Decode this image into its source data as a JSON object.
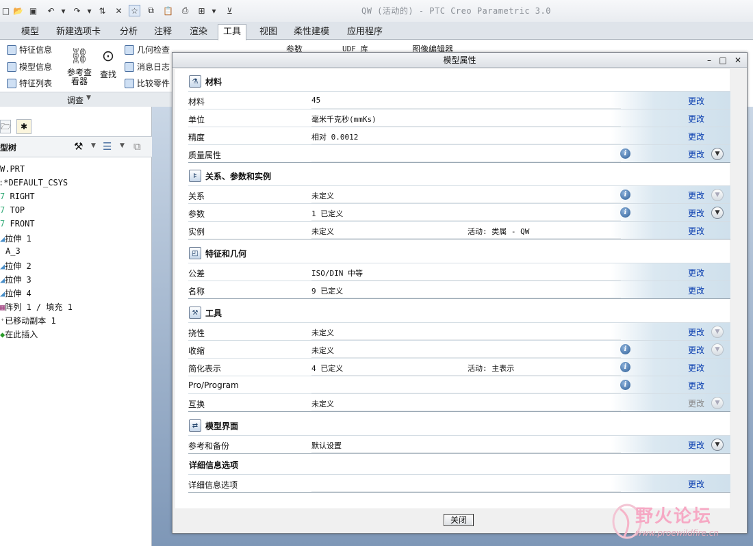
{
  "window": {
    "title": "QW (活动的) - PTC Creo Parametric 3.0"
  },
  "ribbon_tabs": [
    "模型",
    "新建选项卡",
    "分析",
    "注释",
    "渲染",
    "工具",
    "视图",
    "柔性建模",
    "应用程序"
  ],
  "active_tab": "工具",
  "ribbon": {
    "feature_info": "特征信息",
    "model_info": "模型信息",
    "feature_list": "特征列表",
    "ref_viewer": "参考查看器",
    "find": "查找",
    "geom_check": "几何检查",
    "msg_log": "消息日志",
    "compare_part": "比较零件",
    "group_label": "调查",
    "behind_params": "参数",
    "behind_udf": "UDF 库",
    "behind_image_editor": "图像编辑器"
  },
  "model_tree": {
    "header": "型树",
    "items": [
      "W.PRT",
      "*DEFAULT_CSYS",
      "RIGHT",
      "TOP",
      "FRONT",
      "拉伸 1",
      "A_3",
      "拉伸 2",
      "拉伸 3",
      "拉伸 4",
      "阵列 1 / 填充 1",
      "已移动副本 1",
      "在此插入"
    ]
  },
  "dialog": {
    "title": "模型属性",
    "change_label": "更改",
    "close_label": "关闭",
    "sections": [
      {
        "title": "材料",
        "icon": "material-icon",
        "rows": [
          {
            "label": "材料",
            "value": "45",
            "active": "",
            "info": false,
            "expand": "none",
            "enabled": true
          },
          {
            "label": "单位",
            "value": "毫米千克秒(mmKs)",
            "active": "",
            "info": false,
            "expand": "none",
            "enabled": true
          },
          {
            "label": "精度",
            "value": "相对 0.0012",
            "active": "",
            "info": false,
            "expand": "none",
            "enabled": true
          },
          {
            "label": "质量属性",
            "value": "",
            "active": "",
            "info": true,
            "expand": "dark",
            "enabled": true
          }
        ]
      },
      {
        "title": "关系、参数和实例",
        "icon": "relations-icon",
        "rows": [
          {
            "label": "关系",
            "value": "未定义",
            "active": "",
            "info": true,
            "expand": "dim",
            "enabled": true
          },
          {
            "label": "参数",
            "value": "1 已定义",
            "active": "",
            "info": true,
            "expand": "dark",
            "enabled": true
          },
          {
            "label": "实例",
            "value": "未定义",
            "active": "活动: 类属 - QW",
            "info": false,
            "expand": "none",
            "enabled": true
          }
        ]
      },
      {
        "title": "特征和几何",
        "icon": "feature-geometry-icon",
        "rows": [
          {
            "label": "公差",
            "value": "ISO/DIN 中等",
            "active": "",
            "info": false,
            "expand": "none",
            "enabled": true
          },
          {
            "label": "名称",
            "value": "9 已定义",
            "active": "",
            "info": false,
            "expand": "none",
            "enabled": true
          }
        ]
      },
      {
        "title": "工具",
        "icon": "tools-icon",
        "rows": [
          {
            "label": "挠性",
            "value": "未定义",
            "active": "",
            "info": false,
            "expand": "dim",
            "enabled": true
          },
          {
            "label": "收缩",
            "value": "未定义",
            "active": "",
            "info": true,
            "expand": "dim",
            "enabled": true
          },
          {
            "label": "简化表示",
            "value": "4 已定义",
            "active": "活动: 主表示",
            "info": true,
            "expand": "none",
            "enabled": true
          },
          {
            "label": "Pro/Program",
            "value": "",
            "active": "",
            "info": true,
            "expand": "none",
            "enabled": true
          },
          {
            "label": "互换",
            "value": "未定义",
            "active": "",
            "info": false,
            "expand": "dim",
            "enabled": false
          }
        ]
      },
      {
        "title": "模型界面",
        "icon": "model-interface-icon",
        "rows": [
          {
            "label": "参考和备份",
            "value": "默认设置",
            "active": "",
            "info": false,
            "expand": "dark",
            "enabled": true
          }
        ]
      },
      {
        "title": "详细信息选项",
        "icon": "",
        "rows": [
          {
            "label": "详细信息选项",
            "value": "",
            "active": "",
            "info": false,
            "expand": "none",
            "enabled": true
          }
        ]
      }
    ]
  },
  "watermark": {
    "text": "野火论坛",
    "url": "www.proewildfire.cn"
  }
}
